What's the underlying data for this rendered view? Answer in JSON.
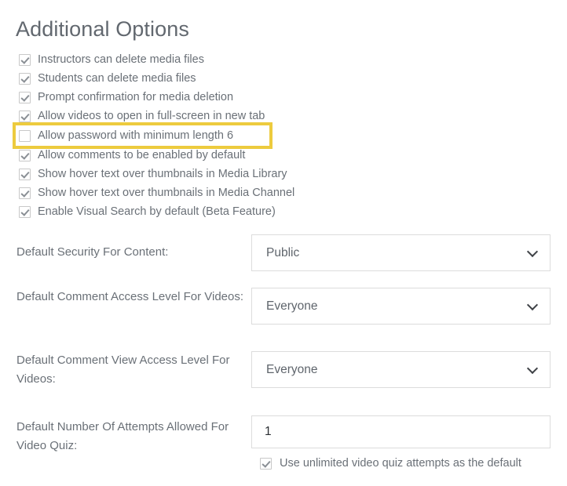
{
  "page": {
    "title": "Additional Options"
  },
  "checkbox_options": [
    {
      "label": "Instructors can delete media files",
      "checked": true,
      "highlighted": false
    },
    {
      "label": "Students can delete media files",
      "checked": true,
      "highlighted": false
    },
    {
      "label": "Prompt confirmation for media deletion",
      "checked": true,
      "highlighted": false
    },
    {
      "label": "Allow videos to open in full-screen in new tab",
      "checked": true,
      "highlighted": false
    },
    {
      "label": "Allow password with minimum length 6",
      "checked": false,
      "highlighted": true
    },
    {
      "label": "Allow comments to be enabled by default",
      "checked": true,
      "highlighted": false
    },
    {
      "label": "Show hover text over thumbnails in Media Library",
      "checked": true,
      "highlighted": false
    },
    {
      "label": "Show hover text over thumbnails in Media Channel",
      "checked": true,
      "highlighted": false
    },
    {
      "label": "Enable Visual Search by default (Beta Feature)",
      "checked": true,
      "highlighted": false
    }
  ],
  "fields": {
    "default_security": {
      "label": "Default Security For Content:",
      "value": "Public",
      "icon": "chevron-down-icon"
    },
    "comment_access_level": {
      "label": "Default Comment Access Level For Videos:",
      "value": "Everyone",
      "icon": "chevron-down-icon"
    },
    "comment_view_access_level": {
      "label": "Default Comment View Access Level For Videos:",
      "value": "Everyone",
      "icon": "chevron-down-icon"
    },
    "video_quiz_attempts": {
      "label": "Default Number Of Attempts Allowed For Video Quiz:",
      "value": "1",
      "placeholder": "",
      "unlimited_checkbox_label": "Use unlimited video quiz attempts as the default",
      "unlimited_checked": true
    }
  },
  "colors": {
    "highlight": "#edcb3e",
    "text": "#6a7077",
    "border": "#dcdcdc",
    "checkbox_border": "#c8c8c8",
    "checkmark": "#8a8f95"
  }
}
